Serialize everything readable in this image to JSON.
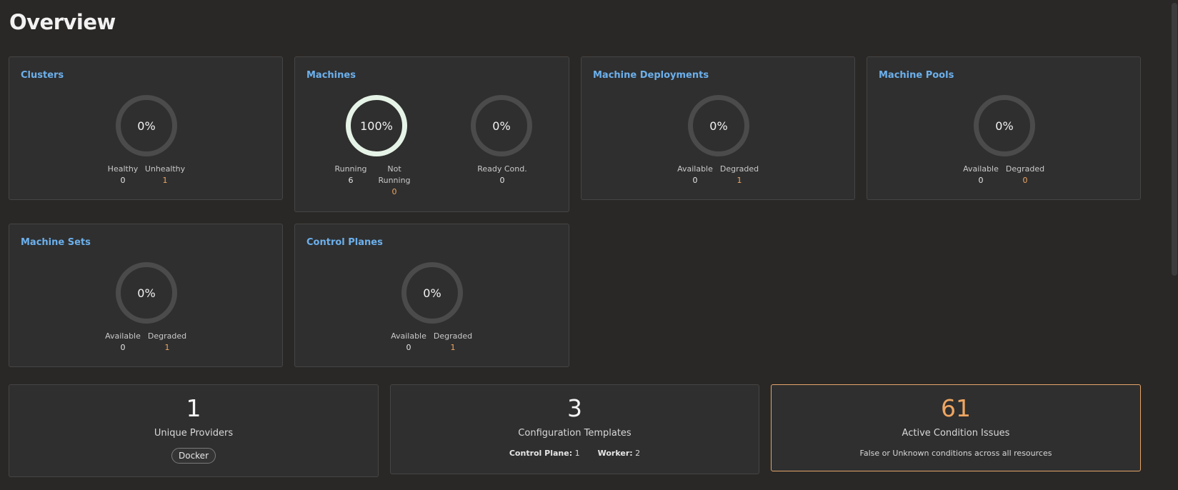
{
  "page": {
    "title": "Overview"
  },
  "cards": {
    "clusters": {
      "title": "Clusters",
      "ring_percent": "0%",
      "stats": [
        {
          "label": "Healthy",
          "value": "0"
        },
        {
          "label": "Unhealthy",
          "value": "1"
        }
      ]
    },
    "machines": {
      "title": "Machines",
      "ring1_percent": "100%",
      "ring2_percent": "0%",
      "stats": [
        {
          "label": "Running",
          "value": "6"
        },
        {
          "label": "Not Running",
          "value": "0"
        },
        {
          "label": "Ready Cond.",
          "value": "0"
        }
      ]
    },
    "machine_deployments": {
      "title": "Machine Deployments",
      "ring_percent": "0%",
      "stats": [
        {
          "label": "Available",
          "value": "0"
        },
        {
          "label": "Degraded",
          "value": "1"
        }
      ]
    },
    "machine_pools": {
      "title": "Machine Pools",
      "ring_percent": "0%",
      "stats": [
        {
          "label": "Available",
          "value": "0"
        },
        {
          "label": "Degraded",
          "value": "0"
        }
      ]
    },
    "machine_sets": {
      "title": "Machine Sets",
      "ring_percent": "0%",
      "stats": [
        {
          "label": "Available",
          "value": "0"
        },
        {
          "label": "Degraded",
          "value": "1"
        }
      ]
    },
    "control_planes": {
      "title": "Control Planes",
      "ring_percent": "0%",
      "stats": [
        {
          "label": "Available",
          "value": "0"
        },
        {
          "label": "Degraded",
          "value": "1"
        }
      ]
    }
  },
  "summary": {
    "providers": {
      "count": "1",
      "label": "Unique Providers",
      "items": [
        "Docker"
      ]
    },
    "templates": {
      "count": "3",
      "label": "Configuration Templates",
      "control_plane_label": "Control Plane:",
      "control_plane_value": "1",
      "worker_label": "Worker:",
      "worker_value": "2"
    },
    "issues": {
      "count": "61",
      "label": "Active Condition Issues",
      "subtitle": "False or Unknown conditions across all resources"
    }
  },
  "colors": {
    "background": "#2a2826",
    "card": "#2f2f2f",
    "link": "#6cb0ec",
    "warning": "#efa662",
    "ring_full": "#e6f3e7",
    "ring_empty": "#4b4b4b"
  }
}
